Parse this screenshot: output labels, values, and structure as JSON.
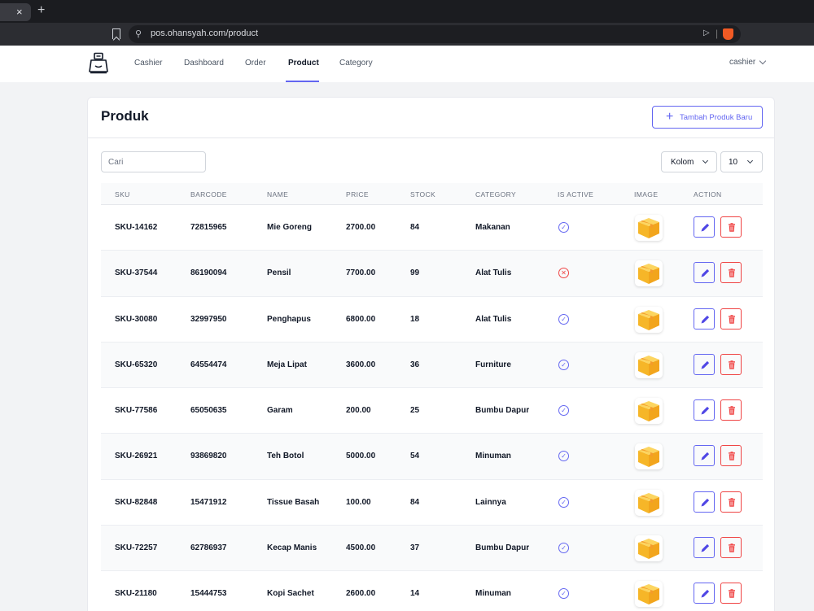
{
  "browser": {
    "tab_close": "×",
    "new_tab": "+",
    "url": "pos.ohansyah.com/product"
  },
  "nav": {
    "items": [
      {
        "label": "Cashier"
      },
      {
        "label": "Dashboard"
      },
      {
        "label": "Order"
      },
      {
        "label": "Product"
      },
      {
        "label": "Category"
      }
    ],
    "active": "Product",
    "user": "cashier"
  },
  "page": {
    "title": "Produk",
    "add_button": "Tambah Produk Baru",
    "search_placeholder": "Cari",
    "columns_button": "Kolom",
    "per_page": "10"
  },
  "table": {
    "headers": [
      "SKU",
      "BARCODE",
      "NAME",
      "PRICE",
      "STOCK",
      "CATEGORY",
      "IS ACTIVE",
      "IMAGE",
      "ACTION"
    ],
    "rows": [
      {
        "sku": "SKU-14162",
        "barcode": "72815965",
        "name": "Mie Goreng",
        "price": "2700.00",
        "stock": "84",
        "category": "Makanan",
        "active": true
      },
      {
        "sku": "SKU-37544",
        "barcode": "86190094",
        "name": "Pensil",
        "price": "7700.00",
        "stock": "99",
        "category": "Alat Tulis",
        "active": false
      },
      {
        "sku": "SKU-30080",
        "barcode": "32997950",
        "name": "Penghapus",
        "price": "6800.00",
        "stock": "18",
        "category": "Alat Tulis",
        "active": true
      },
      {
        "sku": "SKU-65320",
        "barcode": "64554474",
        "name": "Meja Lipat",
        "price": "3600.00",
        "stock": "36",
        "category": "Furniture",
        "active": true
      },
      {
        "sku": "SKU-77586",
        "barcode": "65050635",
        "name": "Garam",
        "price": "200.00",
        "stock": "25",
        "category": "Bumbu Dapur",
        "active": true
      },
      {
        "sku": "SKU-26921",
        "barcode": "93869820",
        "name": "Teh Botol",
        "price": "5000.00",
        "stock": "54",
        "category": "Minuman",
        "active": true
      },
      {
        "sku": "SKU-82848",
        "barcode": "15471912",
        "name": "Tissue Basah",
        "price": "100.00",
        "stock": "84",
        "category": "Lainnya",
        "active": true
      },
      {
        "sku": "SKU-72257",
        "barcode": "62786937",
        "name": "Kecap Manis",
        "price": "4500.00",
        "stock": "37",
        "category": "Bumbu Dapur",
        "active": true
      },
      {
        "sku": "SKU-21180",
        "barcode": "15444753",
        "name": "Kopi Sachet",
        "price": "2600.00",
        "stock": "14",
        "category": "Minuman",
        "active": true
      }
    ]
  },
  "icons": {
    "active": "check-circle-icon",
    "inactive": "x-circle-icon",
    "image": "box-icon",
    "edit": "pencil-icon",
    "delete": "trash-icon"
  },
  "colors": {
    "accent": "#6366f1",
    "danger": "#ef4444",
    "box": "#f5b935"
  }
}
